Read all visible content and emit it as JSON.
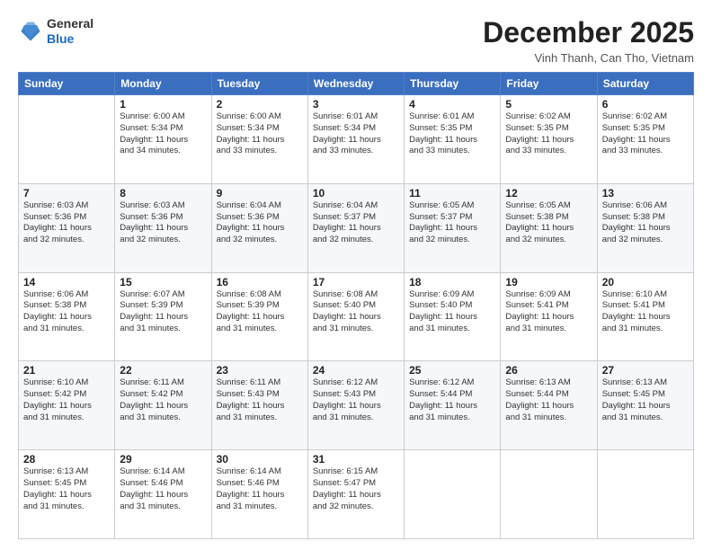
{
  "header": {
    "logo_general": "General",
    "logo_blue": "Blue",
    "month_title": "December 2025",
    "subtitle": "Vinh Thanh, Can Tho, Vietnam"
  },
  "days_of_week": [
    "Sunday",
    "Monday",
    "Tuesday",
    "Wednesday",
    "Thursday",
    "Friday",
    "Saturday"
  ],
  "weeks": [
    [
      {
        "day": "",
        "info": ""
      },
      {
        "day": "1",
        "info": "Sunrise: 6:00 AM\nSunset: 5:34 PM\nDaylight: 11 hours\nand 34 minutes."
      },
      {
        "day": "2",
        "info": "Sunrise: 6:00 AM\nSunset: 5:34 PM\nDaylight: 11 hours\nand 33 minutes."
      },
      {
        "day": "3",
        "info": "Sunrise: 6:01 AM\nSunset: 5:34 PM\nDaylight: 11 hours\nand 33 minutes."
      },
      {
        "day": "4",
        "info": "Sunrise: 6:01 AM\nSunset: 5:35 PM\nDaylight: 11 hours\nand 33 minutes."
      },
      {
        "day": "5",
        "info": "Sunrise: 6:02 AM\nSunset: 5:35 PM\nDaylight: 11 hours\nand 33 minutes."
      },
      {
        "day": "6",
        "info": "Sunrise: 6:02 AM\nSunset: 5:35 PM\nDaylight: 11 hours\nand 33 minutes."
      }
    ],
    [
      {
        "day": "7",
        "info": "Sunrise: 6:03 AM\nSunset: 5:36 PM\nDaylight: 11 hours\nand 32 minutes."
      },
      {
        "day": "8",
        "info": "Sunrise: 6:03 AM\nSunset: 5:36 PM\nDaylight: 11 hours\nand 32 minutes."
      },
      {
        "day": "9",
        "info": "Sunrise: 6:04 AM\nSunset: 5:36 PM\nDaylight: 11 hours\nand 32 minutes."
      },
      {
        "day": "10",
        "info": "Sunrise: 6:04 AM\nSunset: 5:37 PM\nDaylight: 11 hours\nand 32 minutes."
      },
      {
        "day": "11",
        "info": "Sunrise: 6:05 AM\nSunset: 5:37 PM\nDaylight: 11 hours\nand 32 minutes."
      },
      {
        "day": "12",
        "info": "Sunrise: 6:05 AM\nSunset: 5:38 PM\nDaylight: 11 hours\nand 32 minutes."
      },
      {
        "day": "13",
        "info": "Sunrise: 6:06 AM\nSunset: 5:38 PM\nDaylight: 11 hours\nand 32 minutes."
      }
    ],
    [
      {
        "day": "14",
        "info": "Sunrise: 6:06 AM\nSunset: 5:38 PM\nDaylight: 11 hours\nand 31 minutes."
      },
      {
        "day": "15",
        "info": "Sunrise: 6:07 AM\nSunset: 5:39 PM\nDaylight: 11 hours\nand 31 minutes."
      },
      {
        "day": "16",
        "info": "Sunrise: 6:08 AM\nSunset: 5:39 PM\nDaylight: 11 hours\nand 31 minutes."
      },
      {
        "day": "17",
        "info": "Sunrise: 6:08 AM\nSunset: 5:40 PM\nDaylight: 11 hours\nand 31 minutes."
      },
      {
        "day": "18",
        "info": "Sunrise: 6:09 AM\nSunset: 5:40 PM\nDaylight: 11 hours\nand 31 minutes."
      },
      {
        "day": "19",
        "info": "Sunrise: 6:09 AM\nSunset: 5:41 PM\nDaylight: 11 hours\nand 31 minutes."
      },
      {
        "day": "20",
        "info": "Sunrise: 6:10 AM\nSunset: 5:41 PM\nDaylight: 11 hours\nand 31 minutes."
      }
    ],
    [
      {
        "day": "21",
        "info": "Sunrise: 6:10 AM\nSunset: 5:42 PM\nDaylight: 11 hours\nand 31 minutes."
      },
      {
        "day": "22",
        "info": "Sunrise: 6:11 AM\nSunset: 5:42 PM\nDaylight: 11 hours\nand 31 minutes."
      },
      {
        "day": "23",
        "info": "Sunrise: 6:11 AM\nSunset: 5:43 PM\nDaylight: 11 hours\nand 31 minutes."
      },
      {
        "day": "24",
        "info": "Sunrise: 6:12 AM\nSunset: 5:43 PM\nDaylight: 11 hours\nand 31 minutes."
      },
      {
        "day": "25",
        "info": "Sunrise: 6:12 AM\nSunset: 5:44 PM\nDaylight: 11 hours\nand 31 minutes."
      },
      {
        "day": "26",
        "info": "Sunrise: 6:13 AM\nSunset: 5:44 PM\nDaylight: 11 hours\nand 31 minutes."
      },
      {
        "day": "27",
        "info": "Sunrise: 6:13 AM\nSunset: 5:45 PM\nDaylight: 11 hours\nand 31 minutes."
      }
    ],
    [
      {
        "day": "28",
        "info": "Sunrise: 6:13 AM\nSunset: 5:45 PM\nDaylight: 11 hours\nand 31 minutes."
      },
      {
        "day": "29",
        "info": "Sunrise: 6:14 AM\nSunset: 5:46 PM\nDaylight: 11 hours\nand 31 minutes."
      },
      {
        "day": "30",
        "info": "Sunrise: 6:14 AM\nSunset: 5:46 PM\nDaylight: 11 hours\nand 31 minutes."
      },
      {
        "day": "31",
        "info": "Sunrise: 6:15 AM\nSunset: 5:47 PM\nDaylight: 11 hours\nand 32 minutes."
      },
      {
        "day": "",
        "info": ""
      },
      {
        "day": "",
        "info": ""
      },
      {
        "day": "",
        "info": ""
      }
    ]
  ]
}
